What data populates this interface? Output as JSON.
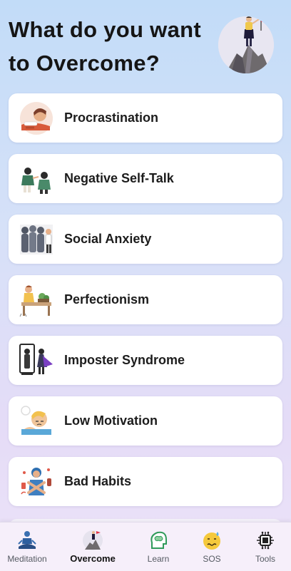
{
  "header": {
    "title": "What do you want to Overcome?",
    "illustration": "person-with-flag-on-mountain-illustration"
  },
  "topics": [
    {
      "label": "Procrastination",
      "icon": "sleeping-person-icon"
    },
    {
      "label": "Negative Self-Talk",
      "icon": "arguing-people-icon"
    },
    {
      "label": "Social Anxiety",
      "icon": "crowd-icon"
    },
    {
      "label": "Perfectionism",
      "icon": "person-at-desk-icon"
    },
    {
      "label": "Imposter Syndrome",
      "icon": "mirror-reflection-icon"
    },
    {
      "label": "Low Motivation",
      "icon": "tired-person-icon"
    },
    {
      "label": "Bad Habits",
      "icon": "refusing-person-icon"
    }
  ],
  "nav": {
    "items": [
      {
        "label": "Meditation",
        "icon": "meditation-icon"
      },
      {
        "label": "Overcome",
        "icon": "overcome-icon"
      },
      {
        "label": "Learn",
        "icon": "brain-head-icon"
      },
      {
        "label": "SOS",
        "icon": "anxious-face-icon"
      },
      {
        "label": "Tools",
        "icon": "ai-chip-icon"
      }
    ],
    "active": "Overcome"
  },
  "colors": {
    "background_top": "#c2dcf8",
    "background_bottom": "#ece3f8",
    "card": "#ffffff",
    "text": "#151515"
  }
}
